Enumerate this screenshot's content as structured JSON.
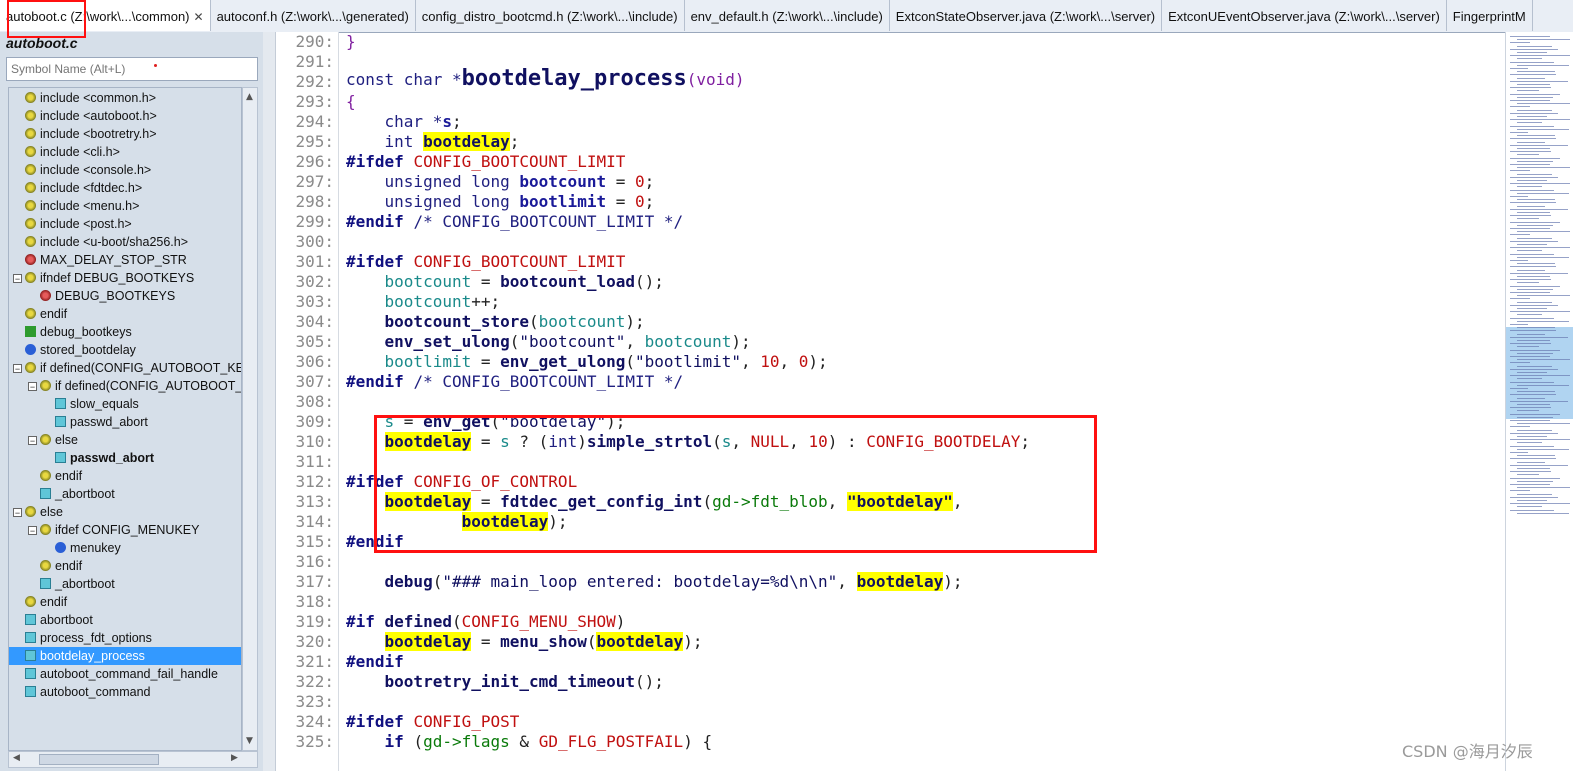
{
  "tabs": [
    {
      "label": "autoboot.c (Z:\\work\\...\\common)",
      "active": true,
      "close": "✕"
    },
    {
      "label": "autoconf.h (Z:\\work\\...\\generated)"
    },
    {
      "label": "config_distro_bootcmd.h (Z:\\work\\...\\include)"
    },
    {
      "label": "env_default.h (Z:\\work\\...\\include)"
    },
    {
      "label": "ExtconStateObserver.java (Z:\\work\\...\\server)"
    },
    {
      "label": "ExtconUEventObserver.java (Z:\\work\\...\\server)"
    },
    {
      "label": "FingerprintM"
    }
  ],
  "panel": {
    "file_title": "autoboot.c",
    "search_placeholder": "Symbol Name (Alt+L)"
  },
  "tree": [
    {
      "label": "include <common.h>",
      "icon": "include-icon",
      "depth": 0
    },
    {
      "label": "include <autoboot.h>",
      "icon": "include-icon",
      "depth": 0
    },
    {
      "label": "include <bootretry.h>",
      "icon": "include-icon",
      "depth": 0
    },
    {
      "label": "include <cli.h>",
      "icon": "include-icon",
      "depth": 0
    },
    {
      "label": "include <console.h>",
      "icon": "include-icon",
      "depth": 0
    },
    {
      "label": "include <fdtdec.h>",
      "icon": "include-icon",
      "depth": 0
    },
    {
      "label": "include <menu.h>",
      "icon": "include-icon",
      "depth": 0
    },
    {
      "label": "include <post.h>",
      "icon": "include-icon",
      "depth": 0
    },
    {
      "label": "include <u-boot/sha256.h>",
      "icon": "include-icon",
      "depth": 0
    },
    {
      "label": "MAX_DELAY_STOP_STR",
      "icon": "define-icon",
      "depth": 0
    },
    {
      "label": "ifndef DEBUG_BOOTKEYS",
      "icon": "include-icon",
      "depth": 0,
      "expander": "−"
    },
    {
      "label": "DEBUG_BOOTKEYS",
      "icon": "define-icon",
      "depth": 1
    },
    {
      "label": "endif",
      "icon": "include-icon",
      "depth": 0
    },
    {
      "label": "debug_bootkeys",
      "icon": "macro-icon",
      "depth": 0
    },
    {
      "label": "stored_bootdelay",
      "icon": "variable-icon",
      "depth": 0
    },
    {
      "label": "if defined(CONFIG_AUTOBOOT_KEY",
      "icon": "include-icon",
      "depth": 0,
      "expander": "−"
    },
    {
      "label": "if defined(CONFIG_AUTOBOOT_S",
      "icon": "include-icon",
      "depth": 1,
      "expander": "−"
    },
    {
      "label": "slow_equals",
      "icon": "function-icon",
      "depth": 2
    },
    {
      "label": "passwd_abort",
      "icon": "function-icon",
      "depth": 2
    },
    {
      "label": "else",
      "icon": "include-icon",
      "depth": 1,
      "expander": "−"
    },
    {
      "label": "passwd_abort",
      "icon": "function-icon",
      "depth": 2,
      "bold": true
    },
    {
      "label": "endif",
      "icon": "include-icon",
      "depth": 1
    },
    {
      "label": "_abortboot",
      "icon": "function-icon",
      "depth": 1
    },
    {
      "label": "else",
      "icon": "include-icon",
      "depth": 0,
      "expander": "−"
    },
    {
      "label": "ifdef CONFIG_MENUKEY",
      "icon": "include-icon",
      "depth": 1,
      "expander": "−"
    },
    {
      "label": "menukey",
      "icon": "variable-icon",
      "depth": 2
    },
    {
      "label": "endif",
      "icon": "include-icon",
      "depth": 1
    },
    {
      "label": "_abortboot",
      "icon": "function-icon",
      "depth": 1
    },
    {
      "label": "endif",
      "icon": "include-icon",
      "depth": 0
    },
    {
      "label": "abortboot",
      "icon": "function-icon",
      "depth": 0
    },
    {
      "label": "process_fdt_options",
      "icon": "function-icon",
      "depth": 0
    },
    {
      "label": "bootdelay_process",
      "icon": "function-icon",
      "depth": 0,
      "selected": true
    },
    {
      "label": "autoboot_command_fail_handle",
      "icon": "function-icon",
      "depth": 0
    },
    {
      "label": "autoboot_command",
      "icon": "function-icon",
      "depth": 0
    }
  ],
  "line_numbers": [
    "290:",
    "291:",
    "292:",
    "293:",
    "294:",
    "295:",
    "296:",
    "297:",
    "298:",
    "299:",
    "300:",
    "301:",
    "302:",
    "303:",
    "304:",
    "305:",
    "306:",
    "307:",
    "308:",
    "309:",
    "310:",
    "311:",
    "312:",
    "313:",
    "314:",
    "315:",
    "316:",
    "317:",
    "318:",
    "319:",
    "320:",
    "321:",
    "322:",
    "323:",
    "324:",
    "325:"
  ],
  "code": [
    [
      {
        "t": "}",
        "c": "br"
      }
    ],
    [],
    [
      {
        "t": "const char *",
        "c": "kw"
      },
      {
        "t": "bootdelay_process",
        "c": "big"
      },
      {
        "t": "(void)",
        "c": "br"
      }
    ],
    [
      {
        "t": "{",
        "c": "br"
      }
    ],
    [
      {
        "t": "    char *",
        "c": "kw"
      },
      {
        "t": "s",
        "c": "var"
      },
      {
        "t": ";",
        "c": ""
      }
    ],
    [
      {
        "t": "    int ",
        "c": "kw"
      },
      {
        "t": "bootdelay",
        "c": "hl"
      },
      {
        "t": ";",
        "c": ""
      }
    ],
    [
      {
        "t": "#ifdef ",
        "c": "pp"
      },
      {
        "t": "CONFIG_BOOTCOUNT_LIMIT",
        "c": "mac"
      }
    ],
    [
      {
        "t": "    unsigned long ",
        "c": "kw"
      },
      {
        "t": "bootcount",
        "c": "var"
      },
      {
        "t": " = ",
        "c": ""
      },
      {
        "t": "0",
        "c": "num"
      },
      {
        "t": ";",
        "c": ""
      }
    ],
    [
      {
        "t": "    unsigned long ",
        "c": "kw"
      },
      {
        "t": "bootlimit",
        "c": "var"
      },
      {
        "t": " = ",
        "c": ""
      },
      {
        "t": "0",
        "c": "num"
      },
      {
        "t": ";",
        "c": ""
      }
    ],
    [
      {
        "t": "#endif ",
        "c": "pp"
      },
      {
        "t": "/* CONFIG_BOOTCOUNT_LIMIT */",
        "c": "cm"
      }
    ],
    [],
    [
      {
        "t": "#ifdef ",
        "c": "pp"
      },
      {
        "t": "CONFIG_BOOTCOUNT_LIMIT",
        "c": "mac"
      }
    ],
    [
      {
        "t": "    bootcount",
        "c": "var2"
      },
      {
        "t": " = ",
        "c": ""
      },
      {
        "t": "bootcount_load",
        "c": "fnb"
      },
      {
        "t": "();",
        "c": ""
      }
    ],
    [
      {
        "t": "    bootcount",
        "c": "var2"
      },
      {
        "t": "++;",
        "c": ""
      }
    ],
    [
      {
        "t": "    bootcount_store",
        "c": "fnb"
      },
      {
        "t": "(",
        "c": ""
      },
      {
        "t": "bootcount",
        "c": "var2"
      },
      {
        "t": ");",
        "c": ""
      }
    ],
    [
      {
        "t": "    env_set_ulong",
        "c": "fnb"
      },
      {
        "t": "(",
        "c": ""
      },
      {
        "t": "\"bootcount\"",
        "c": "str"
      },
      {
        "t": ", ",
        "c": ""
      },
      {
        "t": "bootcount",
        "c": "var2"
      },
      {
        "t": ");",
        "c": ""
      }
    ],
    [
      {
        "t": "    bootlimit",
        "c": "var2"
      },
      {
        "t": " = ",
        "c": ""
      },
      {
        "t": "env_get_ulong",
        "c": "fnb"
      },
      {
        "t": "(",
        "c": ""
      },
      {
        "t": "\"bootlimit\"",
        "c": "str"
      },
      {
        "t": ", ",
        "c": ""
      },
      {
        "t": "10",
        "c": "num"
      },
      {
        "t": ", ",
        "c": ""
      },
      {
        "t": "0",
        "c": "num"
      },
      {
        "t": ");",
        "c": ""
      }
    ],
    [
      {
        "t": "#endif ",
        "c": "pp"
      },
      {
        "t": "/* CONFIG_BOOTCOUNT_LIMIT */",
        "c": "cm"
      }
    ],
    [],
    [
      {
        "t": "    s",
        "c": "var2"
      },
      {
        "t": " = ",
        "c": ""
      },
      {
        "t": "env_get",
        "c": "fnb"
      },
      {
        "t": "(",
        "c": ""
      },
      {
        "t": "\"bootdelay\"",
        "c": "str"
      },
      {
        "t": ");",
        "c": ""
      }
    ],
    [
      {
        "t": "    ",
        "c": ""
      },
      {
        "t": "bootdelay",
        "c": "hl"
      },
      {
        "t": " = ",
        "c": ""
      },
      {
        "t": "s",
        "c": "var2"
      },
      {
        "t": " ? (",
        "c": ""
      },
      {
        "t": "int",
        "c": "kw"
      },
      {
        "t": ")",
        "c": ""
      },
      {
        "t": "simple_strtol",
        "c": "fnb"
      },
      {
        "t": "(",
        "c": ""
      },
      {
        "t": "s",
        "c": "var2"
      },
      {
        "t": ", ",
        "c": ""
      },
      {
        "t": "NULL",
        "c": "mac"
      },
      {
        "t": ", ",
        "c": ""
      },
      {
        "t": "10",
        "c": "num"
      },
      {
        "t": ") : ",
        "c": ""
      },
      {
        "t": "CONFIG_BOOTDELAY",
        "c": "mac"
      },
      {
        "t": ";",
        "c": ""
      }
    ],
    [],
    [
      {
        "t": "#ifdef ",
        "c": "pp"
      },
      {
        "t": "CONFIG_OF_CONTROL",
        "c": "mac"
      }
    ],
    [
      {
        "t": "    ",
        "c": ""
      },
      {
        "t": "bootdelay",
        "c": "hl"
      },
      {
        "t": " = ",
        "c": ""
      },
      {
        "t": "fdtdec_get_config_int",
        "c": "fnb"
      },
      {
        "t": "(",
        "c": ""
      },
      {
        "t": "gd->fdt_blob",
        "c": "green"
      },
      {
        "t": ", ",
        "c": ""
      },
      {
        "t": "\"bootdelay\"",
        "c": "hl"
      },
      {
        "t": ",",
        "c": ""
      }
    ],
    [
      {
        "t": "            ",
        "c": ""
      },
      {
        "t": "bootdelay",
        "c": "hl"
      },
      {
        "t": ");",
        "c": ""
      }
    ],
    [
      {
        "t": "#endif",
        "c": "pp"
      }
    ],
    [],
    [
      {
        "t": "    debug",
        "c": "fnb"
      },
      {
        "t": "(",
        "c": ""
      },
      {
        "t": "\"### main_loop entered: bootdelay=%d\\n\\n\"",
        "c": "str"
      },
      {
        "t": ", ",
        "c": ""
      },
      {
        "t": "bootdelay",
        "c": "hl"
      },
      {
        "t": ");",
        "c": ""
      }
    ],
    [],
    [
      {
        "t": "#if ",
        "c": "pp"
      },
      {
        "t": "defined",
        "c": "fnb"
      },
      {
        "t": "(",
        "c": ""
      },
      {
        "t": "CONFIG_MENU_SHOW",
        "c": "mac"
      },
      {
        "t": ")",
        "c": ""
      }
    ],
    [
      {
        "t": "    ",
        "c": ""
      },
      {
        "t": "bootdelay",
        "c": "hl"
      },
      {
        "t": " = ",
        "c": ""
      },
      {
        "t": "menu_show",
        "c": "fnb"
      },
      {
        "t": "(",
        "c": ""
      },
      {
        "t": "bootdelay",
        "c": "hl"
      },
      {
        "t": ");",
        "c": ""
      }
    ],
    [
      {
        "t": "#endif",
        "c": "pp"
      }
    ],
    [
      {
        "t": "    bootretry_init_cmd_timeout",
        "c": "fnb"
      },
      {
        "t": "();",
        "c": ""
      }
    ],
    [],
    [
      {
        "t": "#ifdef ",
        "c": "pp"
      },
      {
        "t": "CONFIG_POST",
        "c": "mac"
      }
    ],
    [
      {
        "t": "    if ",
        "c": "pp"
      },
      {
        "t": "(",
        "c": ""
      },
      {
        "t": "gd->flags",
        "c": "green"
      },
      {
        "t": " & ",
        "c": ""
      },
      {
        "t": "GD_FLG_POSTFAIL",
        "c": "mac"
      },
      {
        "t": ") {",
        "c": ""
      }
    ]
  ],
  "watermark": "CSDN @海月汐辰",
  "colors": {
    "highlight": "#ffff00",
    "selection": "#3399ff",
    "annotation": "#ff1010"
  }
}
